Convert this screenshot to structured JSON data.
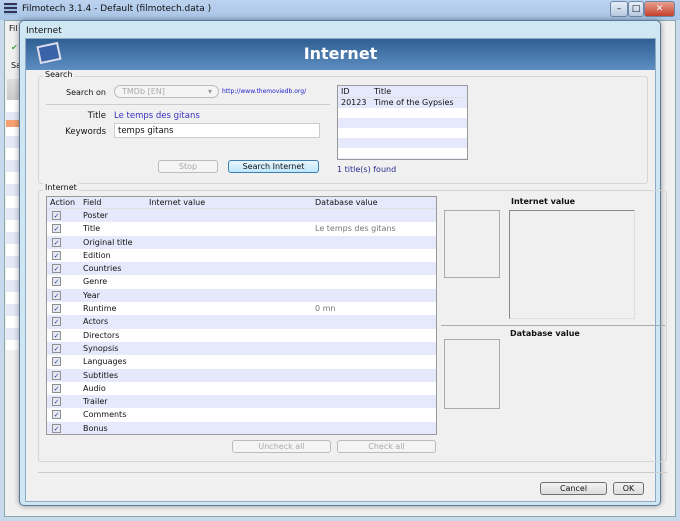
{
  "main_window": {
    "title": "Filmotech 3.1.4 - Default (filmotech.data )",
    "menu_first": "Fil",
    "toolbar_first": "Sa",
    "minimize": "–",
    "maximize": "□",
    "close": "✕"
  },
  "dialog": {
    "title": "Internet",
    "banner_title": "Internet"
  },
  "search": {
    "group_label": "Search",
    "search_on_label": "Search on",
    "search_on_value": "TMDb [EN]",
    "site_link": "http://www.themoviedb.org/",
    "title_label": "Title",
    "title_value": "Le temps des gitans",
    "keywords_label": "Keywords",
    "keywords_value": "temps gitans",
    "stop_label": "Stop",
    "search_label": "Search Internet"
  },
  "results": {
    "columns": [
      "ID",
      "Title"
    ],
    "rows": [
      {
        "id": "20123",
        "title": "Time of the Gypsies"
      }
    ],
    "found": "1 title(s) found"
  },
  "internet": {
    "group_label": "Internet",
    "columns": [
      "Action",
      "Field",
      "Internet value",
      "Database value"
    ],
    "rows": [
      {
        "field": "Poster",
        "internet": "",
        "database": ""
      },
      {
        "field": "Title",
        "internet": "",
        "database": "Le temps des gitans"
      },
      {
        "field": "Original title",
        "internet": "",
        "database": ""
      },
      {
        "field": "Edition",
        "internet": "",
        "database": ""
      },
      {
        "field": "Countries",
        "internet": "",
        "database": ""
      },
      {
        "field": "Genre",
        "internet": "",
        "database": ""
      },
      {
        "field": "Year",
        "internet": "",
        "database": ""
      },
      {
        "field": "Runtime",
        "internet": "",
        "database": "0 mn"
      },
      {
        "field": "Actors",
        "internet": "",
        "database": ""
      },
      {
        "field": "Directors",
        "internet": "",
        "database": ""
      },
      {
        "field": "Synopsis",
        "internet": "",
        "database": ""
      },
      {
        "field": "Languages",
        "internet": "",
        "database": ""
      },
      {
        "field": "Subtitles",
        "internet": "",
        "database": ""
      },
      {
        "field": "Audio",
        "internet": "",
        "database": ""
      },
      {
        "field": "Trailer",
        "internet": "",
        "database": ""
      },
      {
        "field": "Comments",
        "internet": "",
        "database": ""
      },
      {
        "field": "Bonus",
        "internet": "",
        "database": ""
      }
    ],
    "uncheck_all": "Uncheck all",
    "check_all": "Check all",
    "internet_value_label": "Internet value",
    "database_value_label": "Database value"
  },
  "footer": {
    "cancel": "Cancel",
    "ok": "OK"
  }
}
